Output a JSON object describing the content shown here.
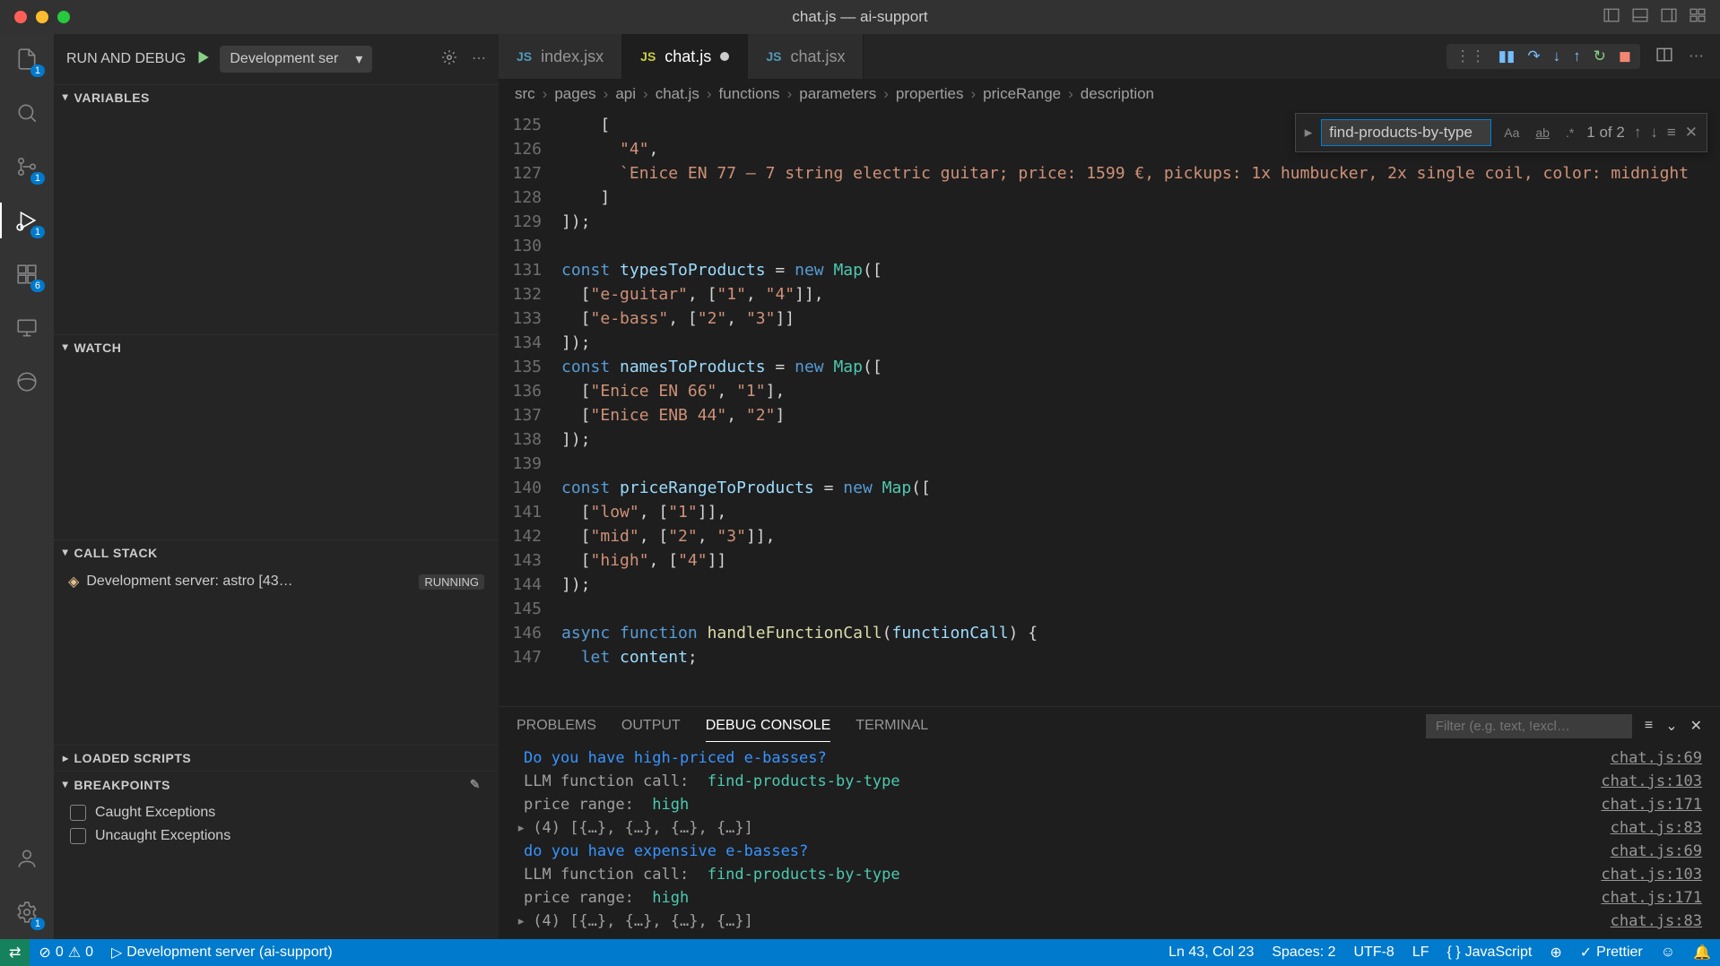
{
  "window": {
    "title": "chat.js — ai-support"
  },
  "runDebug": {
    "label": "RUN AND DEBUG",
    "config": "Development ser"
  },
  "panels": {
    "variables": "VARIABLES",
    "watch": "WATCH",
    "callStack": "CALL STACK",
    "loadedScripts": "LOADED SCRIPTS",
    "breakpoints": "BREAKPOINTS"
  },
  "callStack": {
    "item": "Development server: astro [43…",
    "status": "RUNNING"
  },
  "breakpoints": {
    "caught": "Caught Exceptions",
    "uncaught": "Uncaught Exceptions"
  },
  "tabs": [
    {
      "icon": "jsx",
      "label": "index.jsx",
      "active": false
    },
    {
      "icon": "js",
      "label": "chat.js",
      "active": true,
      "dirty": true
    },
    {
      "icon": "jsx",
      "label": "chat.jsx",
      "active": false
    }
  ],
  "breadcrumbs": [
    "src",
    "pages",
    "api",
    "chat.js",
    "functions",
    "parameters",
    "properties",
    "priceRange",
    "description"
  ],
  "search": {
    "value": "find-products-by-type",
    "count": "1 of 2"
  },
  "code": [
    {
      "n": 125,
      "html": "    ["
    },
    {
      "n": 126,
      "html": "      <span class='tok-str'>\"4\"</span>,"
    },
    {
      "n": 127,
      "html": "      <span class='tok-str'>`Enice EN 77 – 7 string electric guitar; price: 1599 €, pickups: 1x humbucker, 2x single coil, color: midnight</span>"
    },
    {
      "n": 128,
      "html": "    ]"
    },
    {
      "n": 129,
      "html": "]);"
    },
    {
      "n": 130,
      "html": ""
    },
    {
      "n": 131,
      "html": "<span class='tok-kw'>const</span> <span class='tok-var'>typesToProducts</span> = <span class='tok-kw'>new</span> <span class='tok-type'>Map</span>(["
    },
    {
      "n": 132,
      "html": "  [<span class='tok-str'>\"e-guitar\"</span>, [<span class='tok-str'>\"1\"</span>, <span class='tok-str'>\"4\"</span>]],"
    },
    {
      "n": 133,
      "html": "  [<span class='tok-str'>\"e-bass\"</span>, [<span class='tok-str'>\"2\"</span>, <span class='tok-str'>\"3\"</span>]]"
    },
    {
      "n": 134,
      "html": "]);"
    },
    {
      "n": 135,
      "html": "<span class='tok-kw'>const</span> <span class='tok-var'>namesToProducts</span> = <span class='tok-kw'>new</span> <span class='tok-type'>Map</span>(["
    },
    {
      "n": 136,
      "html": "  [<span class='tok-str'>\"Enice EN 66\"</span>, <span class='tok-str'>\"1\"</span>],"
    },
    {
      "n": 137,
      "html": "  [<span class='tok-str'>\"Enice ENB 44\"</span>, <span class='tok-str'>\"2\"</span>]"
    },
    {
      "n": 138,
      "html": "]);"
    },
    {
      "n": 139,
      "html": ""
    },
    {
      "n": 140,
      "html": "<span class='tok-kw'>const</span> <span class='tok-var'>priceRangeToProducts</span> = <span class='tok-kw'>new</span> <span class='tok-type'>Map</span>(["
    },
    {
      "n": 141,
      "html": "  [<span class='tok-str'>\"low\"</span>, [<span class='tok-str'>\"1\"</span>]],"
    },
    {
      "n": 142,
      "html": "  [<span class='tok-str'>\"mid\"</span>, [<span class='tok-str'>\"2\"</span>, <span class='tok-str'>\"3\"</span>]],"
    },
    {
      "n": 143,
      "html": "  [<span class='tok-str'>\"high\"</span>, [<span class='tok-str'>\"4\"</span>]]"
    },
    {
      "n": 144,
      "html": "]);"
    },
    {
      "n": 145,
      "html": ""
    },
    {
      "n": 146,
      "html": "<span class='tok-kw'>async</span> <span class='tok-kw'>function</span> <span class='tok-fn'>handleFunctionCall</span>(<span class='tok-var'>functionCall</span>) {"
    },
    {
      "n": 147,
      "html": "  <span class='tok-kw'>let</span> <span class='tok-var'>content</span>;"
    }
  ],
  "panelTabs": {
    "problems": "PROBLEMS",
    "output": "OUTPUT",
    "debugConsole": "DEBUG CONSOLE",
    "terminal": "TERMINAL"
  },
  "filterPlaceholder": "Filter (e.g. text, !excl…",
  "console": [
    {
      "cls": "c-blue",
      "text": "Do you have high-priced e-basses?",
      "src": "chat.js:69"
    },
    {
      "cls": "c-gray",
      "text": "LLM function call:  <span class='c-green'>find-products-by-type</span>",
      "src": "chat.js:103"
    },
    {
      "cls": "c-gray",
      "text": "price range:  <span class='c-green'>high</span>",
      "src": "chat.js:171"
    },
    {
      "expand": true,
      "cls": "c-gray",
      "text": "(4) [{…}, {…}, {…}, {…}]",
      "src": "chat.js:83"
    },
    {
      "cls": "c-blue",
      "text": "do you have expensive e-basses?",
      "src": "chat.js:69"
    },
    {
      "cls": "c-gray",
      "text": "LLM function call:  <span class='c-green'>find-products-by-type</span>",
      "src": "chat.js:103"
    },
    {
      "cls": "c-gray",
      "text": "price range:  <span class='c-green'>high</span>",
      "src": "chat.js:171"
    },
    {
      "expand": true,
      "cls": "c-gray",
      "text": "(4) [{…}, {…}, {…}, {…}]",
      "src": "chat.js:83"
    }
  ],
  "status": {
    "errors": "0",
    "warnings": "0",
    "process": "Development server (ai-support)",
    "cursor": "Ln 43, Col 23",
    "spaces": "Spaces: 2",
    "encoding": "UTF-8",
    "eol": "LF",
    "lang": "JavaScript",
    "prettier": "Prettier"
  },
  "badges": {
    "explorer": "1",
    "scm": "1",
    "debug": "1",
    "ext": "6",
    "remote": "1"
  }
}
